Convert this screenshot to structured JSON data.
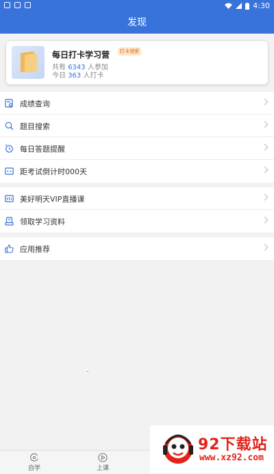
{
  "status_bar": {
    "time": "4:30"
  },
  "header": {
    "title": "发现"
  },
  "promo": {
    "title": "每日打卡学习营",
    "badge": "打卡领奖",
    "line1_prefix": "共有",
    "line1_count": "6343",
    "line1_suffix": "人参加",
    "line2_prefix": "今日",
    "line2_count": "363",
    "line2_suffix": "人打卡"
  },
  "menu_group_1": [
    {
      "label": "成绩查询",
      "icon": "score-query-icon"
    },
    {
      "label": "题目搜索",
      "icon": "search-icon"
    },
    {
      "label": "每日答题提醒",
      "icon": "alarm-clock-icon"
    },
    {
      "label": "距考试倒计时000天",
      "icon": "countdown-icon"
    }
  ],
  "menu_group_2": [
    {
      "label": "美好明天VIP直播课",
      "icon": "live-stream-icon"
    },
    {
      "label": "领取学习资料",
      "icon": "study-material-icon"
    }
  ],
  "menu_group_3": [
    {
      "label": "应用推荐",
      "icon": "thumbs-up-icon"
    }
  ],
  "tabbar": {
    "tabs": [
      {
        "label": "自学",
        "icon": "self-study-icon"
      },
      {
        "label": "上课",
        "icon": "play-icon"
      }
    ]
  },
  "watermark": {
    "title": "92下载站",
    "url": "www.xz92.com"
  },
  "colors": {
    "primary": "#3773db",
    "accent": "#e8541b",
    "watermark": "#e2231a"
  }
}
